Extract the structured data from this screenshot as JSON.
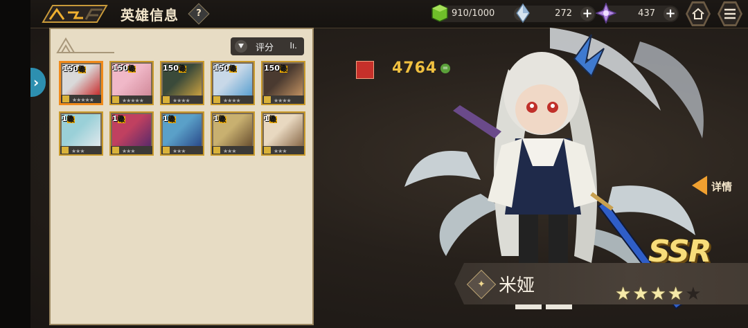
{
  "header": {
    "title": "英雄信息",
    "help_label": "?",
    "gems_green": "910/1000",
    "crystal_blue": "272",
    "crystal_purple": "437",
    "plus_label": "+"
  },
  "roster": {
    "sort_label": "评分",
    "heroes": [
      {
        "level": "150",
        "unit": "级",
        "stars": "★★★★★",
        "selected": true
      },
      {
        "level": "150",
        "unit": "级",
        "stars": "★★★★★"
      },
      {
        "level": "150",
        "unit": "级",
        "stars": "★★★★"
      },
      {
        "level": "150",
        "unit": "级",
        "stars": "★★★★"
      },
      {
        "level": "150",
        "unit": "级",
        "stars": "★★★★"
      },
      {
        "level": "1",
        "unit": "级",
        "stars": "★★★"
      },
      {
        "level": "1",
        "unit": "级",
        "stars": "★★★"
      },
      {
        "level": "1",
        "unit": "级",
        "stars": "★★★"
      },
      {
        "level": "1",
        "unit": "级",
        "stars": "★★★"
      },
      {
        "level": "1",
        "unit": "级",
        "stars": "★★★"
      }
    ]
  },
  "character": {
    "power": "4764",
    "detail_label": "详情",
    "rarity": "SSR",
    "name": "米娅",
    "stars_filled": 4,
    "stars_total": 5
  }
}
